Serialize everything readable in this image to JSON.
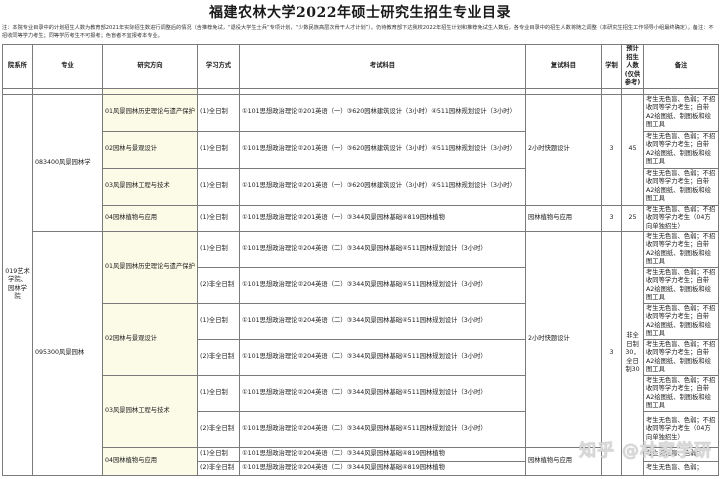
{
  "title": "福建农林大学2022年硕士研究生招生专业目录",
  "note": "注：本院专业目录中的计划招生人数为教育部2021年实际招生数进行调整后的情况（含推荐免试，“退役大学生士兵”专项计划，“少数民族高层次骨干人才计划”）。仍待教育部下达我校2022年招生计划和推荐免试生人数后，各专业目录中的招生人数将随之调整（本研究生招生工作领导小组最终确定）。备注：不招收同等学力考生；同等学历考生不可报考；色盲者不宜报考本专业。",
  "headers": {
    "dept": "院系所",
    "major": "专业",
    "direction": "研究方向",
    "mode": "学习方式",
    "exam": "考试科目",
    "retest": "复试科目",
    "years": "学制",
    "plan": "预计招生人数(仅供参考)",
    "remark": "备注"
  },
  "dept": "019艺术学院、园林学院",
  "majors": {
    "m1": "083400风景园林学",
    "m2": "095300风景园林"
  },
  "rows": [
    {
      "direction": "01风景园林历史理论与遗产保护",
      "mode": "(1)全日制",
      "exam": "①101思想政治理论②201英语（一）③620园林建筑设计（3小时）④511园林规划设计（3小时）",
      "remark": "考生无色盲、色弱；不招收同等学力考生；自带A2绘图纸、制图板和绘图工具"
    },
    {
      "direction": "02园林与景观设计",
      "mode": "(1)全日制",
      "exam": "①101思想政治理论②201英语（一）③620园林建筑设计（3小时）④511园林规划设计（3小时）",
      "remark": "考生无色盲、色弱；不招收同等学力考生；自带A2绘图纸、制图板和绘图工具"
    },
    {
      "direction": "03风景园林工程与技术",
      "mode": "(1)全日制",
      "exam": "①101思想政治理论②201英语（一）③620园林建筑设计（3小时）④511园林规划设计（3小时）",
      "remark": "考生无色盲、色弱；不招收同等学力考生；自带A2绘图纸、制图板和绘图工具"
    },
    {
      "direction": "04园林植物与应用",
      "mode": "(1)全日制",
      "exam": "①101思想政治理论②201英语（一）③344风景园林基础④819园林植物",
      "remark": "考生无色盲、色弱；不招收同等学力考生（04方向单独招生）"
    },
    {
      "direction": "01风景园林历史理论与遗产保护",
      "mode": "(1)全日制",
      "exam": "①101思想政治理论②204英语（二）③344风景园林基础④511园林规划设计（3小时）",
      "remark": "考生无色盲、色弱；不招收同等学力考生；自带A2绘图纸、制图板和绘图工具"
    },
    {
      "direction": "",
      "mode": "(2)非全日制",
      "exam": "①101思想政治理论②204英语（二）③344风景园林基础④511园林规划设计（3小时）",
      "remark": "考生无色盲、色弱；不招收同等学力考生；自带A2绘图纸、制图板和绘图工具"
    },
    {
      "direction": "02园林与景观设计",
      "mode": "(1)全日制",
      "exam": "①101思想政治理论②204英语（二）③344风景园林基础④511园林规划设计（3小时）",
      "remark": "考生无色盲、色弱；不招收同等学力考生；自带A2绘图纸、制图板和绘图工具"
    },
    {
      "direction": "",
      "mode": "(2)非全日制",
      "exam": "①101思想政治理论②204英语（二）③344风景园林基础④511园林规划设计（3小时）",
      "remark": "考生无色盲、色弱；不招收同等学力考生；自带A2绘图纸、制图板和绘图工具"
    },
    {
      "direction": "03风景园林工程与技术",
      "mode": "(1)全日制",
      "exam": "①101思想政治理论②204英语（二）③344风景园林基础④511园林规划设计（3小时）",
      "remark": "考生无色盲、色弱；不招收同等学力考生；自带A2绘图纸、制图板和绘图工具"
    },
    {
      "direction": "",
      "mode": "(2)非全日制",
      "exam": "①101思想政治理论②204英语（二）③344风景园林基础④511园林规划设计（3小时）",
      "remark": "考生无色盲、色弱；不招收同等学力考生（04方向单独招生）"
    },
    {
      "direction": "04园林植物与应用",
      "mode": "(1)全日制",
      "exam": "①101思想政治理论②204英语（二）③344风景园林基础④819园林植物",
      "remark": "考生无色盲、色弱；"
    },
    {
      "direction": "",
      "mode": "(2)非全日制",
      "exam": "①101思想政治理论②204英语（二）③344风景园林基础④819园林植物",
      "remark": "考生无色盲、色弱；"
    }
  ],
  "retest": {
    "m1_a": "2小时快题设计",
    "m1_b": "园林植物与应用",
    "m2_a": "2小时快题设计",
    "m2_b": "园林植物与应用"
  },
  "years": {
    "m1": "3",
    "m1_b": "3",
    "m2": "3"
  },
  "plan": {
    "m1": "45",
    "m1_b": "25",
    "m2": "非全日制30，全日制30"
  },
  "watermark": "知乎 @林家学研"
}
